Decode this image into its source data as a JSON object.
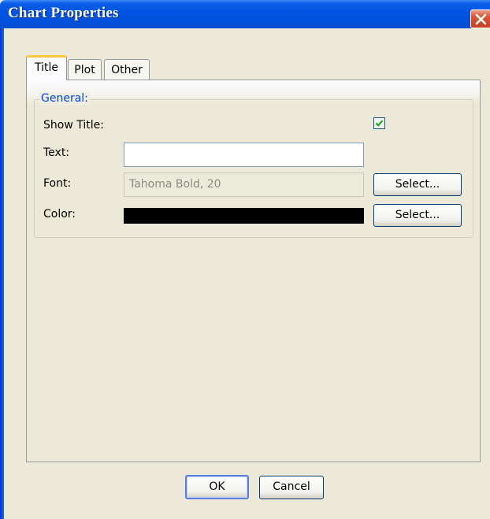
{
  "window": {
    "title": "Chart Properties"
  },
  "tabs": [
    {
      "label": "Title",
      "active": true
    },
    {
      "label": "Plot",
      "active": false
    },
    {
      "label": "Other",
      "active": false
    }
  ],
  "general": {
    "legend": "General:",
    "show_title_label": "Show Title:",
    "show_title_checked": true,
    "text_label": "Text:",
    "text_value": "",
    "font_label": "Font:",
    "font_value": "Tahoma Bold, 20",
    "font_select_label": "Select...",
    "color_label": "Color:",
    "color_value": "#000000",
    "color_select_label": "Select..."
  },
  "footer": {
    "ok_label": "OK",
    "cancel_label": "Cancel"
  },
  "icons": {
    "close": "close-icon",
    "check": "check-icon"
  },
  "colors": {
    "titlebar": "#0054e3",
    "accent_tab": "#ffc83c",
    "group_legend": "#0046d5",
    "close_button": "#d8593a"
  }
}
